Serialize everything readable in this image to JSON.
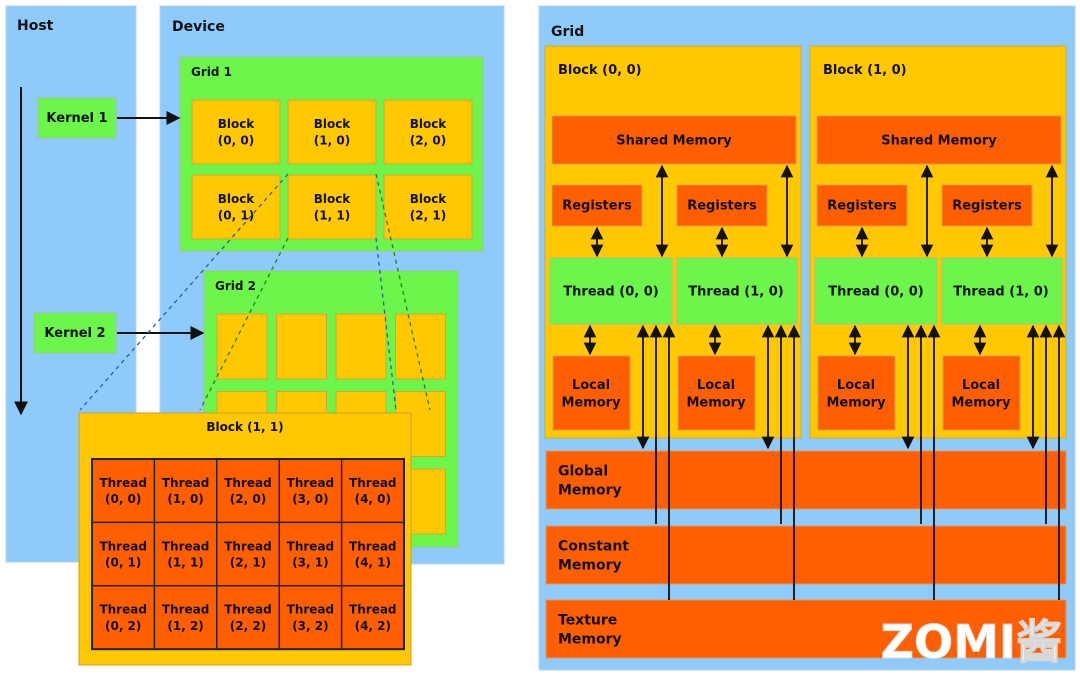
{
  "colors": {
    "panel_blue": "#8ecbfb",
    "grid_green": "#6cf54a",
    "block_yellow": "#ffc800",
    "memory_orange": "#ff5f00",
    "border_gray": "#a8a8a8",
    "line_black": "#111111"
  },
  "left": {
    "host": {
      "title": "Host",
      "kernels": [
        "Kernel 1",
        "Kernel 2"
      ]
    },
    "device": {
      "title": "Device",
      "grid1": {
        "title": "Grid 1",
        "blocks": [
          [
            "Block",
            "(0, 0)"
          ],
          [
            "Block",
            "(1, 0)"
          ],
          [
            "Block",
            "(2, 0)"
          ],
          [
            "Block",
            "(0, 1)"
          ],
          [
            "Block",
            "(1, 1)"
          ],
          [
            "Block",
            "(2, 1)"
          ]
        ]
      },
      "grid2": {
        "title": "Grid 2",
        "block_count": 12
      }
    },
    "zoom_block": {
      "title": "Block (1, 1)",
      "threads": [
        [
          "Thread",
          "(0, 0)"
        ],
        [
          "Thread",
          "(1, 0)"
        ],
        [
          "Thread",
          "(2, 0)"
        ],
        [
          "Thread",
          "(3, 0)"
        ],
        [
          "Thread",
          "(4, 0)"
        ],
        [
          "Thread",
          "(0, 1)"
        ],
        [
          "Thread",
          "(1, 1)"
        ],
        [
          "Thread",
          "(2, 1)"
        ],
        [
          "Thread",
          "(3, 1)"
        ],
        [
          "Thread",
          "(4, 1)"
        ],
        [
          "Thread",
          "(0, 2)"
        ],
        [
          "Thread",
          "(1, 2)"
        ],
        [
          "Thread",
          "(2, 2)"
        ],
        [
          "Thread",
          "(3, 2)"
        ],
        [
          "Thread",
          "(4, 2)"
        ]
      ]
    }
  },
  "right": {
    "title": "Grid",
    "blocks": [
      {
        "title": "Block (0, 0)",
        "shared": "Shared Memory",
        "registers": [
          "Registers",
          "Registers"
        ],
        "threads": [
          "Thread (0, 0)",
          "Thread (1, 0)"
        ],
        "local": [
          [
            "Local",
            "Memory"
          ],
          [
            "Local",
            "Memory"
          ]
        ]
      },
      {
        "title": "Block (1, 0)",
        "shared": "Shared Memory",
        "registers": [
          "Registers",
          "Registers"
        ],
        "threads": [
          "Thread (0, 0)",
          "Thread (1, 0)"
        ],
        "local": [
          [
            "Local",
            "Memory"
          ],
          [
            "Local",
            "Memory"
          ]
        ]
      }
    ],
    "memories": [
      [
        "Global",
        "Memory"
      ],
      [
        "Constant",
        "Memory"
      ],
      [
        "Texture",
        "Memory"
      ]
    ]
  },
  "watermark": "ZOMI酱"
}
